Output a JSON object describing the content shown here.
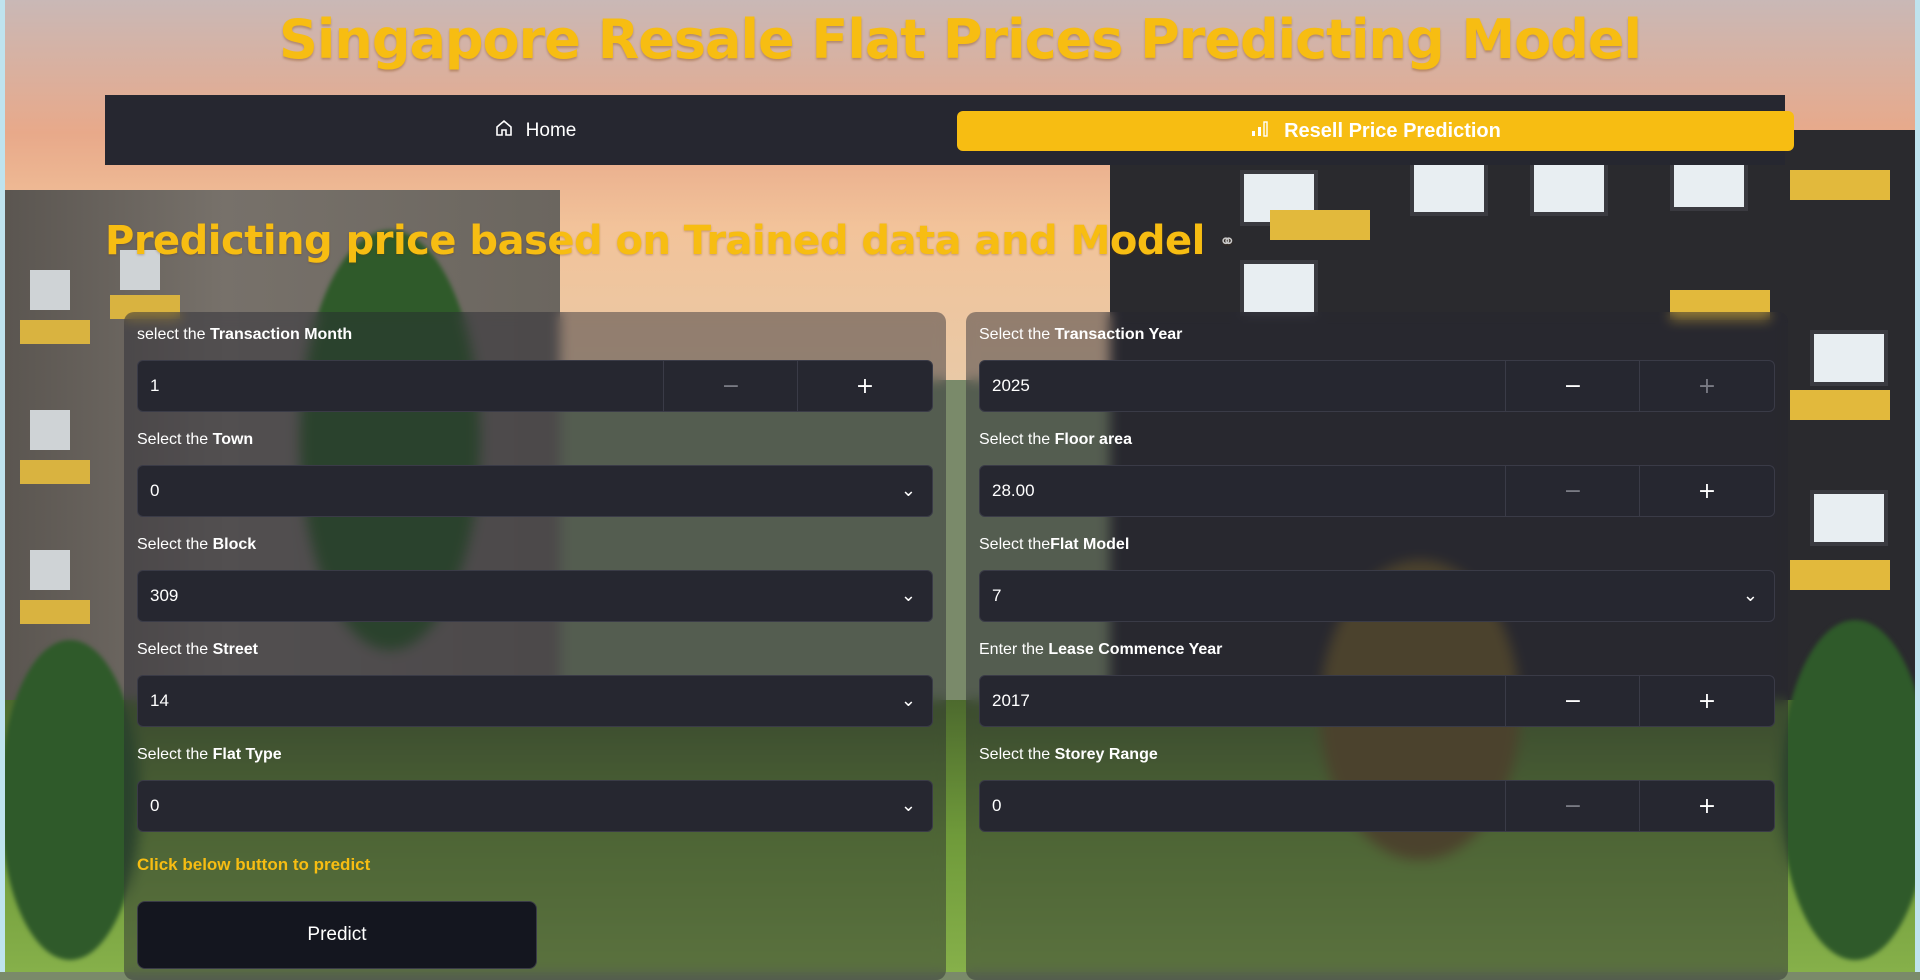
{
  "page": {
    "title": "Singapore Resale Flat Prices Predicting Model"
  },
  "nav": {
    "home_label": "Home",
    "home_icon": "home-icon",
    "prediction_label": "Resell Price Prediction",
    "prediction_icon": "bar-chart-icon",
    "active": "Resell Price Prediction"
  },
  "section": {
    "heading": "Predicting price based on Trained data and Model"
  },
  "fields": {
    "transaction_month": {
      "prefix": "select the ",
      "name": "Transaction Month",
      "value": "1"
    },
    "town": {
      "prefix": "Select the ",
      "name": "Town",
      "value": "0"
    },
    "block": {
      "prefix": "Select the ",
      "name": "Block",
      "value": "309"
    },
    "street": {
      "prefix": "Select the ",
      "name": "Street",
      "value": "14"
    },
    "flat_type": {
      "prefix": "Select the ",
      "name": "Flat Type",
      "value": "0"
    },
    "transaction_year": {
      "prefix": "Select the ",
      "name": "Transaction Year",
      "value": "2025"
    },
    "floor_area": {
      "prefix": "Select the ",
      "name": "Floor area",
      "value": "28.00"
    },
    "flat_model": {
      "prefix": "Select the",
      "name": "Flat Model",
      "value": "7"
    },
    "lease_commence_year": {
      "prefix": "Enter the ",
      "name": "Lease Commence Year",
      "value": "2017"
    },
    "storey_range": {
      "prefix": "Select the ",
      "name": "Storey Range",
      "value": "0"
    }
  },
  "hint": "Click below button to predict",
  "predict_label": "Predict",
  "colors": {
    "accent": "#f7bd12",
    "panel": "#262730"
  }
}
